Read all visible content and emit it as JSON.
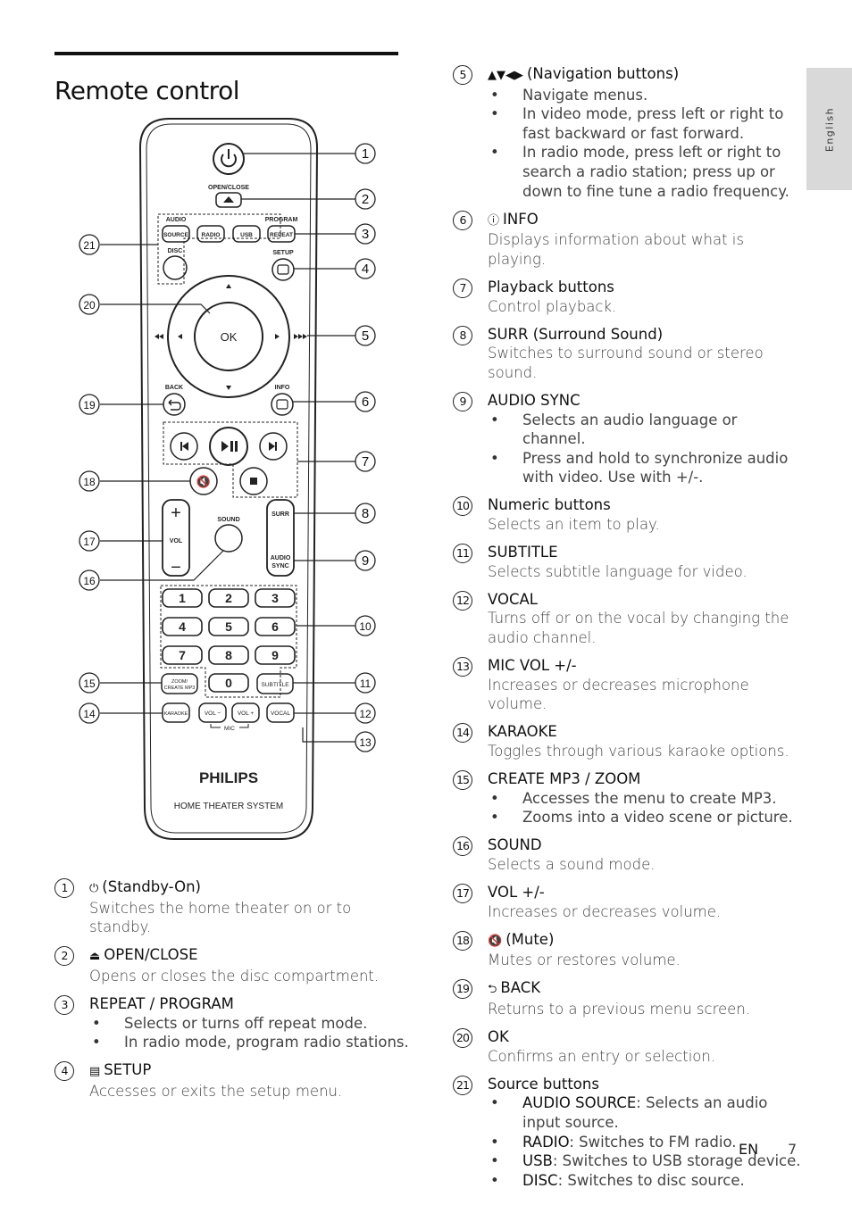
{
  "page": {
    "title": "Remote control",
    "side_tab": "English",
    "footer_lang": "EN",
    "footer_page": "7"
  },
  "remote": {
    "brand": "PHILIPS",
    "model_text": "HOME THEATER SYSTEM",
    "labels": {
      "open_close": "OPEN/CLOSE",
      "audio": "AUDIO",
      "source": "SOURCE",
      "radio": "RADIO",
      "usb": "USB",
      "program": "PROGRAM",
      "repeat": "REPEAT",
      "disc": "DISC",
      "setup": "SETUP",
      "ok": "OK",
      "back": "BACK",
      "info": "INFO",
      "sound": "SOUND",
      "vol": "VOL",
      "surr": "SURR",
      "audio_sync_1": "AUDIO",
      "audio_sync_2": "SYNC",
      "zoom_1": "ZOOM/",
      "zoom_2": "CREATE MP3",
      "subtitle": "SUBTITLE",
      "karaoke": "KARAOKE",
      "mic_vol_minus": "VOL −",
      "mic_vol_plus": "VOL +",
      "vocal": "VOCAL",
      "mic": "MIC"
    },
    "numeric_keys": [
      "1",
      "2",
      "3",
      "4",
      "5",
      "6",
      "7",
      "8",
      "9",
      "0"
    ],
    "callouts_right": [
      "1",
      "2",
      "3",
      "4",
      "5",
      "6",
      "7",
      "8",
      "9",
      "10",
      "11",
      "12",
      "13"
    ],
    "callouts_left": [
      "21",
      "20",
      "19",
      "18",
      "17",
      "16",
      "15",
      "14"
    ]
  },
  "items_left": [
    {
      "num": "1",
      "icon": "⏻",
      "head": "(Standby-On)",
      "desc": "Switches the home theater on or to standby."
    },
    {
      "num": "2",
      "icon": "⏏",
      "head": "OPEN/CLOSE",
      "desc": "Opens or closes the disc compartment."
    },
    {
      "num": "3",
      "head": "REPEAT / PROGRAM",
      "bullets": [
        "Selects or turns off repeat mode.",
        "In radio mode, program radio stations."
      ]
    },
    {
      "num": "4",
      "icon": "▤",
      "head": "SETUP",
      "desc": "Accesses or exits the setup menu."
    }
  ],
  "items_right": [
    {
      "num": "5",
      "icon": "▲▼◀▶",
      "head": "(Navigation buttons)",
      "bullets": [
        "Navigate menus.",
        "In video mode, press left or right to fast backward or fast forward.",
        "In radio mode, press left or right to search a radio station; press up or down to fine tune a radio frequency."
      ]
    },
    {
      "num": "6",
      "icon": "ⓘ",
      "head": "INFO",
      "desc": "Displays information about what is playing."
    },
    {
      "num": "7",
      "head": "Playback buttons",
      "desc": "Control playback."
    },
    {
      "num": "8",
      "head": "SURR (Surround Sound)",
      "desc": "Switches to surround sound or stereo sound."
    },
    {
      "num": "9",
      "head": "AUDIO SYNC",
      "bullets": [
        "Selects an audio language or channel.",
        "Press and hold to synchronize audio with video. Use with +/-."
      ]
    },
    {
      "num": "10",
      "head": "Numeric buttons",
      "desc": "Selects an item to play."
    },
    {
      "num": "11",
      "head": "SUBTITLE",
      "desc": "Selects subtitle language for video."
    },
    {
      "num": "12",
      "head": "VOCAL",
      "desc": "Turns off or on the vocal by changing the audio channel."
    },
    {
      "num": "13",
      "head": "MIC VOL +/-",
      "desc": "Increases or decreases microphone volume."
    },
    {
      "num": "14",
      "head": "KARAOKE",
      "desc": "Toggles through various karaoke options."
    },
    {
      "num": "15",
      "head": "CREATE MP3 / ZOOM",
      "bullets": [
        "Accesses the menu to create MP3.",
        "Zooms into a video scene or picture."
      ]
    },
    {
      "num": "16",
      "head": "SOUND",
      "desc": "Selects a sound mode."
    },
    {
      "num": "17",
      "head": "VOL +/-",
      "desc": "Increases or decreases volume."
    },
    {
      "num": "18",
      "icon": "🔇",
      "head": "(Mute)",
      "desc": "Mutes or restores volume."
    },
    {
      "num": "19",
      "icon": "⮌",
      "head": "BACK",
      "desc": "Returns to a previous menu screen."
    },
    {
      "num": "20",
      "head": "OK",
      "desc": "Confirms an entry or selection."
    },
    {
      "num": "21",
      "head": "Source buttons",
      "bullets_kv": [
        {
          "key": "AUDIO SOURCE",
          "text": ": Selects an audio input source."
        },
        {
          "key": "RADIO",
          "text": ": Switches to FM radio."
        },
        {
          "key": "USB",
          "text": ": Switches to USB storage device."
        },
        {
          "key": "DISC",
          "text": ": Switches to disc source."
        }
      ]
    }
  ]
}
